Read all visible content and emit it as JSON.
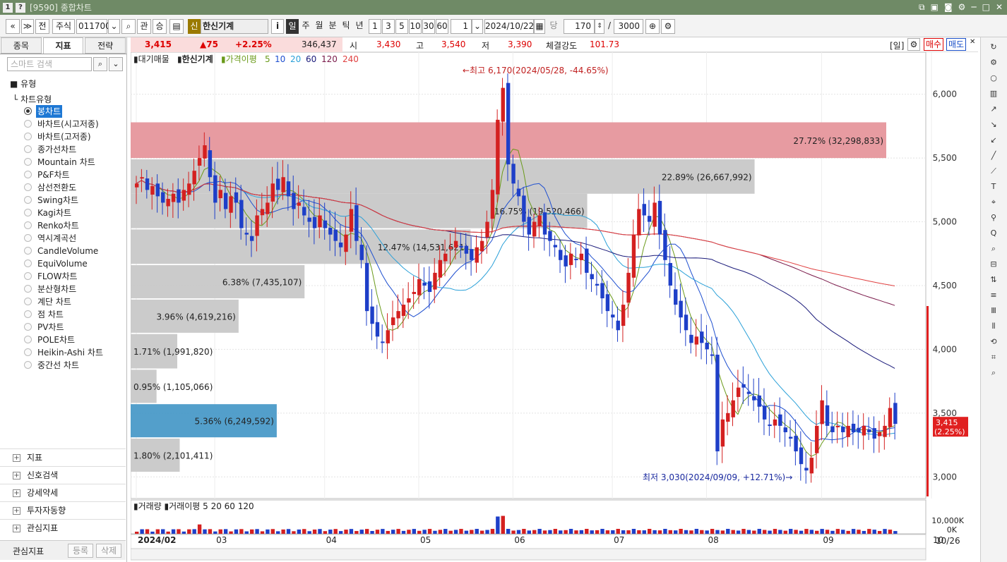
{
  "window": {
    "id_badge": "1",
    "help_badge": "?",
    "title": "[9590] 종합차트"
  },
  "toolbar": {
    "nav_prev": "«",
    "nav_menu": "≫",
    "prev_btn": "전",
    "market": "주식",
    "code": "011700",
    "gwan": "관",
    "up_down": "승",
    "stock_badge": "신",
    "stock_name": "한신기계",
    "info": "i",
    "periods": [
      "일",
      "주",
      "월",
      "분",
      "틱",
      "년"
    ],
    "intervals": [
      "1",
      "3",
      "5",
      "10",
      "30",
      "60"
    ],
    "interval_value": "1",
    "date": "2024/10/22",
    "dang": "당",
    "count": "170",
    "slash": "/",
    "total": "3000"
  },
  "left_panel": {
    "tabs": [
      "종목",
      "지표",
      "전략"
    ],
    "search_placeholder": "스마트 검색",
    "type_header": "유형",
    "chart_type_header": "차트유형",
    "chart_types": [
      "봉차트",
      "바차트(시고저종)",
      "바차트(고저종)",
      "종가선차트",
      "Mountain 차트",
      "P&F차트",
      "삼선전환도",
      "Swing차트",
      "Kagi차트",
      "Renko차트",
      "역시계곡선",
      "CandleVolume",
      "EquiVolume",
      "FLOW차트",
      "분산형차트",
      "계단 차트",
      "점 차트",
      "PV차트",
      "POLE차트",
      "Heikin-Ashi 차트",
      "중간선 차트"
    ],
    "groups": [
      "지표",
      "신호검색",
      "강세약세",
      "투자자동향",
      "관심지표"
    ],
    "fav_label": "관심지표",
    "fav_add": "등록",
    "fav_del": "삭제"
  },
  "quote": {
    "price": "3,415",
    "change": "▲75",
    "pct": "+2.25%",
    "volume": "346,437",
    "open_label": "시",
    "open": "3,430",
    "high_label": "고",
    "high": "3,540",
    "low_label": "저",
    "low": "3,390",
    "strength_label": "체결강도",
    "strength": "101.73",
    "period_tag": "[일]",
    "buy": "매수",
    "sell": "매도"
  },
  "chart_data": {
    "type": "candlestick",
    "legend": [
      "대기매물",
      "한신기계",
      "가격이평",
      "5",
      "10",
      "20",
      "60",
      "120",
      "240"
    ],
    "ma_colors": {
      "5": "#6a9a1a",
      "10": "#1e4fd0",
      "20": "#2aa0d8",
      "60": "#1a1a7a",
      "120": "#7a1a4a",
      "240": "#e04040"
    },
    "y_ticks": [
      3000,
      3500,
      4000,
      4500,
      5000,
      5500,
      6000
    ],
    "y_tick_labels": [
      "3,000",
      "3,500",
      "4,000",
      "4,500",
      "5,000",
      "5,500",
      "6,000"
    ],
    "ylim": [
      2830,
      6330
    ],
    "months": [
      "2024/02",
      "03",
      "04",
      "05",
      "06",
      "07",
      "08",
      "09",
      "10"
    ],
    "current_price_label": "3,415",
    "current_pct_label": "(2.25%)",
    "high_annotation": "←최고 6,170(2024/05/28, -44.65%)",
    "low_annotation": "최저 3,030(2024/09/09, +12.71%)→",
    "volume_profile": [
      {
        "low": 5500,
        "high": 5780,
        "label": "27.72% (32,298,833)",
        "pct": 27.72,
        "color": "#e6969c"
      },
      {
        "low": 5220,
        "high": 5490,
        "label": "22.89% (26,667,992)",
        "pct": 22.89,
        "color": "#c8c8c8"
      },
      {
        "low": 4950,
        "high": 5220,
        "label": "16.75% (19,520,466)",
        "pct": 16.75,
        "color": "#c8c8c8"
      },
      {
        "low": 4670,
        "high": 4940,
        "label": "12.47% (14,531,621)",
        "pct": 12.47,
        "color": "#c8c8c8"
      },
      {
        "low": 4400,
        "high": 4660,
        "label": "6.38% (7,435,107)",
        "pct": 6.38,
        "color": "#c8c8c8"
      },
      {
        "low": 4130,
        "high": 4390,
        "label": "3.96% (4,619,216)",
        "pct": 3.96,
        "color": "#c8c8c8"
      },
      {
        "low": 3850,
        "high": 4120,
        "label": "1.71% (1,991,820)",
        "pct": 1.71,
        "color": "#c8c8c8"
      },
      {
        "low": 3580,
        "high": 3840,
        "label": "0.95% (1,105,066)",
        "pct": 0.95,
        "color": "#c8c8c8"
      },
      {
        "low": 3310,
        "high": 3570,
        "label": "5.36% (6,249,592)",
        "pct": 5.36,
        "color": "#4a9ac8"
      },
      {
        "low": 3040,
        "high": 3300,
        "label": "1.80% (2,101,411)",
        "pct": 1.8,
        "color": "#c8c8c8"
      }
    ],
    "closes": [
      5300,
      5350,
      5250,
      5280,
      5200,
      5150,
      5180,
      5220,
      5150,
      5250,
      5300,
      5400,
      5500,
      5600,
      5350,
      5150,
      5250,
      5100,
      5200,
      5150,
      4950,
      4900,
      4850,
      5050,
      5100,
      5150,
      5300,
      5250,
      5350,
      5200,
      5100,
      5150,
      5050,
      5000,
      4950,
      5050,
      4950,
      4900,
      4850,
      4800,
      4900,
      5100,
      4850,
      4700,
      4300,
      4200,
      4100,
      4050,
      4150,
      4250,
      4300,
      4350,
      4400,
      4450,
      4550,
      4500,
      4450,
      4600,
      4700,
      4750,
      4800,
      4850,
      4800,
      4750,
      4700,
      4800,
      4850,
      5000,
      5250,
      5800,
      6050,
      5450,
      5300,
      5200,
      5000,
      4900,
      5000,
      5050,
      4900,
      4850,
      4800,
      4700,
      4650,
      4750,
      4700,
      4750,
      4600,
      4550,
      4500,
      4400,
      4300,
      4250,
      4150,
      4350,
      4600,
      4900,
      5100,
      5050,
      5000,
      5150,
      4900,
      4700,
      4500,
      4350,
      4250,
      4150,
      4050,
      4100,
      4050,
      4000,
      3950,
      3200,
      3450,
      3500,
      3600,
      3700,
      3700,
      3650,
      3600,
      3550,
      3450,
      3400,
      3450,
      3400,
      3350,
      3300,
      3200,
      3100,
      3050,
      3150,
      3400,
      3600,
      3400,
      3350,
      3400,
      3350,
      3400,
      3350,
      3350,
      3400,
      3350,
      3300,
      3350,
      3400,
      3540,
      3415
    ],
    "volume_axis": [
      "10,000K",
      "0K"
    ],
    "volume_legend": [
      "거래량",
      "거래이평",
      "5",
      "20",
      "60",
      "120"
    ],
    "bottom_date": "10/26"
  }
}
